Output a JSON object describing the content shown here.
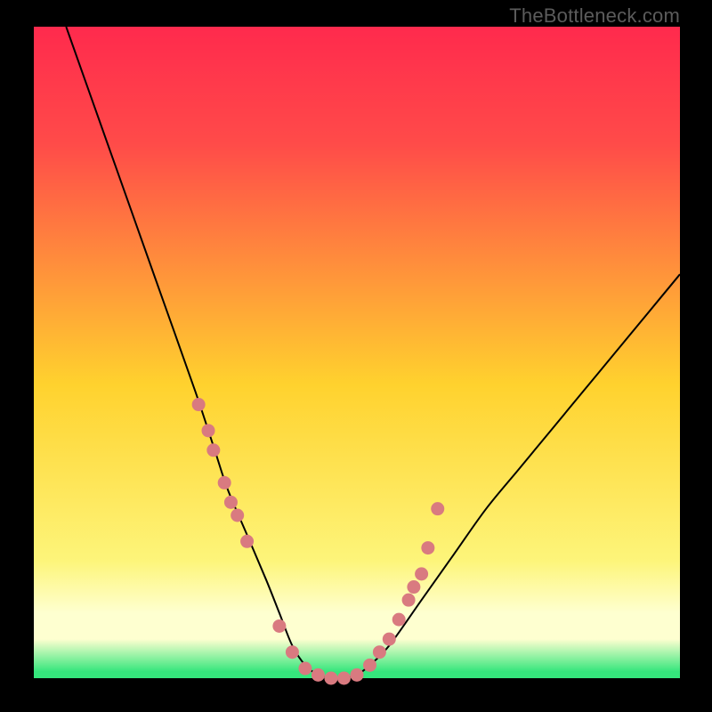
{
  "watermark": "TheBottleneck.com",
  "colors": {
    "top": "#ff2a4d",
    "upper": "#ff4b49",
    "mid": "#ffd22e",
    "low": "#fdf57a",
    "pale": "#feffd0",
    "green": "#35e67c",
    "curve": "#000000",
    "marker": "#d97a80",
    "frame": "#000000"
  },
  "chart_data": {
    "type": "line",
    "title": "",
    "xlabel": "",
    "ylabel": "",
    "xlim": [
      0,
      100
    ],
    "ylim": [
      0,
      100
    ],
    "grid": false,
    "legend": false,
    "series": [
      {
        "name": "bottleneck-curve",
        "x": [
          5,
          10,
          15,
          20,
          25,
          28,
          30,
          33,
          36,
          38,
          40,
          42,
          44,
          46,
          48,
          50,
          52,
          55,
          60,
          65,
          70,
          75,
          80,
          85,
          90,
          95,
          100
        ],
        "y": [
          100,
          86,
          72,
          58,
          44,
          35,
          29,
          22,
          15,
          10,
          5,
          2,
          0.5,
          0,
          0,
          0.5,
          2,
          5,
          12,
          19,
          26,
          32,
          38,
          44,
          50,
          56,
          62
        ]
      }
    ],
    "markers": {
      "name": "highlight-points",
      "note": "pink circular markers on both flanks of the valley",
      "x": [
        25.5,
        27.0,
        27.8,
        29.5,
        30.5,
        31.5,
        33.0,
        38.0,
        40.0,
        42.0,
        44.0,
        46.0,
        48.0,
        50.0,
        52.0,
        53.5,
        55.0,
        56.5,
        58.0,
        58.8,
        60.0,
        61.0,
        62.5
      ],
      "y": [
        42.0,
        38.0,
        35.0,
        30.0,
        27.0,
        25.0,
        21.0,
        8.0,
        4.0,
        1.5,
        0.5,
        0.0,
        0.0,
        0.5,
        2.0,
        4.0,
        6.0,
        9.0,
        12.0,
        14.0,
        16.0,
        20.0,
        26.0
      ]
    },
    "background_gradient": {
      "direction": "vertical",
      "stops": [
        {
          "pos": 0.0,
          "color": "#ff2a4d"
        },
        {
          "pos": 0.18,
          "color": "#ff4b49"
        },
        {
          "pos": 0.55,
          "color": "#ffd22e"
        },
        {
          "pos": 0.82,
          "color": "#fdf57a"
        },
        {
          "pos": 0.92,
          "color": "#feffd0"
        },
        {
          "pos": 0.99,
          "color": "#35e67c"
        },
        {
          "pos": 1.0,
          "color": "#35e67c"
        }
      ]
    }
  }
}
